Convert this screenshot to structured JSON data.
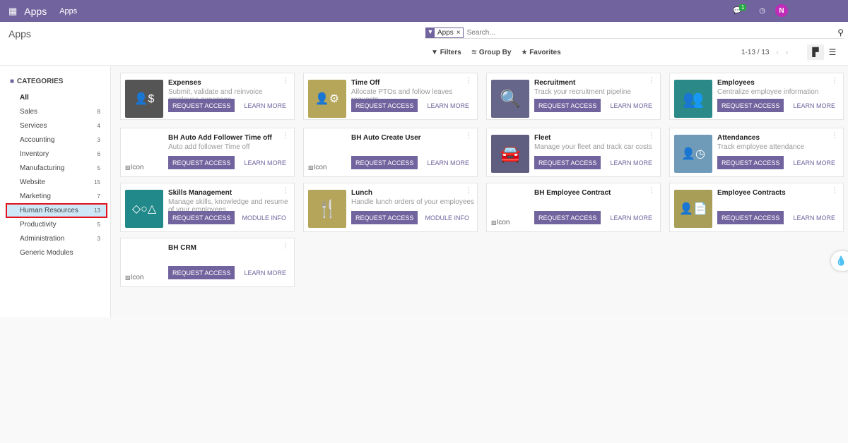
{
  "topbar": {
    "app": "Apps",
    "menu": "Apps",
    "chat_count": "1",
    "avatar": "N"
  },
  "control": {
    "title": "Apps",
    "facet": "Apps",
    "search_placeholder": "Search...",
    "filters": "Filters",
    "group_by": "Group By",
    "favorites": "Favorites",
    "pager": "1-13 / 13"
  },
  "sidebar": {
    "header": "CATEGORIES",
    "items": [
      {
        "label": "All",
        "count": ""
      },
      {
        "label": "Sales",
        "count": "8"
      },
      {
        "label": "Services",
        "count": "4"
      },
      {
        "label": "Accounting",
        "count": "3"
      },
      {
        "label": "Inventory",
        "count": "6"
      },
      {
        "label": "Manufacturing",
        "count": "5"
      },
      {
        "label": "Website",
        "count": "15"
      },
      {
        "label": "Marketing",
        "count": "7"
      },
      {
        "label": "Human Resources",
        "count": "13",
        "selected": true
      },
      {
        "label": "Productivity",
        "count": "5"
      },
      {
        "label": "Administration",
        "count": "3"
      },
      {
        "label": "Generic Modules",
        "count": ""
      }
    ]
  },
  "apps": [
    {
      "name": "Expenses",
      "desc": "Submit, validate and reinvoice employee expenses",
      "icon": "expense-icon",
      "glyph": "👤$",
      "color": "#555555",
      "action": "REQUEST ACCESS",
      "link": "LEARN MORE"
    },
    {
      "name": "Time Off",
      "desc": "Allocate PTOs and follow leaves requests",
      "icon": "time-off-icon",
      "glyph": "👤⚙",
      "color": "#b5a65a",
      "action": "REQUEST ACCESS",
      "link": "LEARN MORE"
    },
    {
      "name": "Recruitment",
      "desc": "Track your recruitment pipeline",
      "icon": "magnifier-icon",
      "glyph": "🔍",
      "color": "#66658a",
      "action": "REQUEST ACCESS",
      "link": "LEARN MORE"
    },
    {
      "name": "Employees",
      "desc": "Centralize employee information",
      "icon": "employees-icon",
      "glyph": "👥",
      "color": "#2b8a87",
      "action": "REQUEST ACCESS",
      "link": "LEARN MORE"
    },
    {
      "name": "BH Auto Add Follower Time off",
      "desc": "Auto add follower Time off",
      "icon": "broken-image-icon",
      "glyph": "Icon",
      "color": "",
      "action": "REQUEST ACCESS",
      "link": "LEARN MORE"
    },
    {
      "name": "BH Auto Create User",
      "desc": "",
      "icon": "broken-image-icon",
      "glyph": "Icon",
      "color": "",
      "action": "REQUEST ACCESS",
      "link": "LEARN MORE"
    },
    {
      "name": "Fleet",
      "desc": "Manage your fleet and track car costs",
      "icon": "car-icon",
      "glyph": "🚘",
      "color": "#5f5e80",
      "action": "REQUEST ACCESS",
      "link": "LEARN MORE"
    },
    {
      "name": "Attendances",
      "desc": "Track employee attendance",
      "icon": "attendance-icon",
      "glyph": "👤◷",
      "color": "#6f9ab8",
      "action": "REQUEST ACCESS",
      "link": "LEARN MORE"
    },
    {
      "name": "Skills Management",
      "desc": "Manage skills, knowledge and resume of your employees",
      "icon": "skills-icon",
      "glyph": "◇○△",
      "color": "#22898a",
      "action": "REQUEST ACCESS",
      "link": "MODULE INFO"
    },
    {
      "name": "Lunch",
      "desc": "Handle lunch orders of your employees",
      "icon": "cutlery-icon",
      "glyph": "🍴",
      "color": "#b5a55a",
      "action": "REQUEST ACCESS",
      "link": "MODULE INFO"
    },
    {
      "name": "BH Employee Contract",
      "desc": "",
      "icon": "broken-image-icon",
      "glyph": "Icon",
      "color": "",
      "action": "REQUEST ACCESS",
      "link": "LEARN MORE"
    },
    {
      "name": "Employee Contracts",
      "desc": "",
      "icon": "contract-icon",
      "glyph": "👤📄",
      "color": "#a89e58",
      "action": "REQUEST ACCESS",
      "link": "LEARN MORE"
    },
    {
      "name": "BH CRM",
      "desc": "",
      "icon": "broken-image-icon",
      "glyph": "Icon",
      "color": "",
      "action": "REQUEST ACCESS",
      "link": "LEARN MORE"
    }
  ]
}
